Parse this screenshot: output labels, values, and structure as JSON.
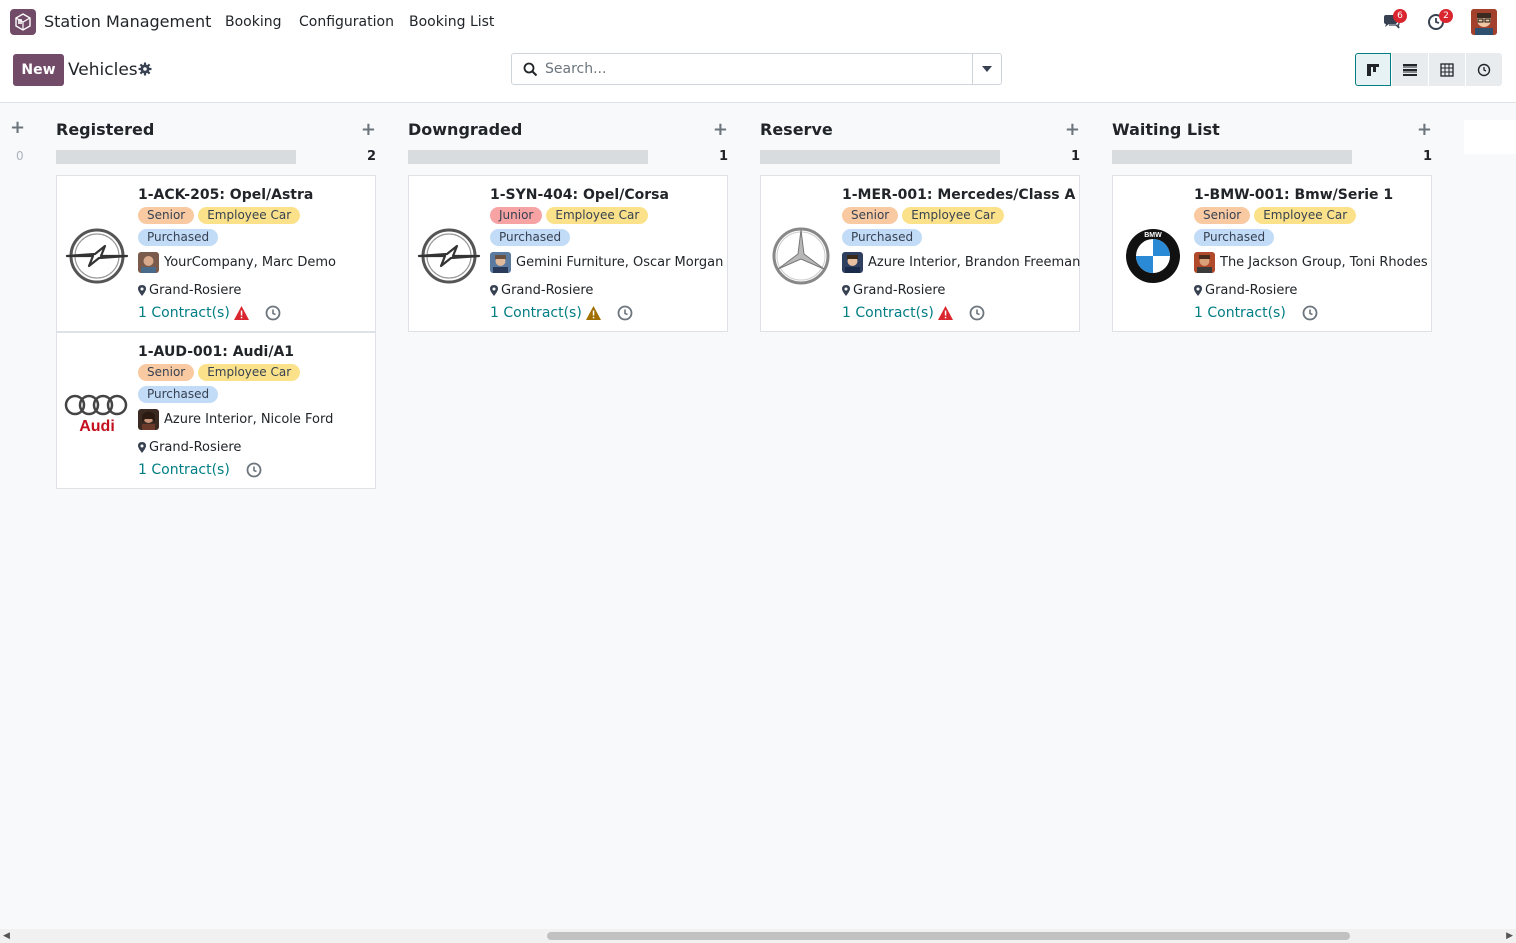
{
  "navbar": {
    "app_name": "Station Management",
    "menu": [
      "Booking",
      "Configuration",
      "Booking List"
    ],
    "messages_count": "6",
    "activities_count": "2"
  },
  "control": {
    "new_label": "New",
    "title": "Vehicles",
    "search_placeholder": "Search..."
  },
  "columns": [
    {
      "title": "Registered",
      "count": "2",
      "cards": [
        {
          "title": "1-ACK-205: Opel/Astra",
          "logo": "opel-logo",
          "tags": [
            "Senior",
            "Employee Car"
          ],
          "status": "Purchased",
          "driver": "YourCompany, Marc Demo",
          "location": "Grand-Rosiere",
          "contracts": "1 Contract(s)",
          "warning": "red"
        },
        {
          "title": "1-AUD-001: Audi/A1",
          "logo": "audi-logo",
          "logo_text": "Audi",
          "tags": [
            "Senior",
            "Employee Car"
          ],
          "status": "Purchased",
          "driver": "Azure Interior, Nicole Ford",
          "location": "Grand-Rosiere",
          "contracts": "1 Contract(s)",
          "warning": ""
        }
      ]
    },
    {
      "title": "Downgraded",
      "count": "1",
      "cards": [
        {
          "title": "1-SYN-404: Opel/Corsa",
          "logo": "opel-logo",
          "tags": [
            "Junior",
            "Employee Car"
          ],
          "status": "Purchased",
          "driver": "Gemini Furniture, Oscar Morgan",
          "location": "Grand-Rosiere",
          "contracts": "1 Contract(s)",
          "warning": "amber"
        }
      ]
    },
    {
      "title": "Reserve",
      "count": "1",
      "cards": [
        {
          "title": "1-MER-001: Mercedes/Class A",
          "logo": "mercedes-logo",
          "tags": [
            "Senior",
            "Employee Car"
          ],
          "status": "Purchased",
          "driver": "Azure Interior, Brandon Freeman",
          "location": "Grand-Rosiere",
          "contracts": "1 Contract(s)",
          "warning": "red"
        }
      ]
    },
    {
      "title": "Waiting List",
      "count": "1",
      "cards": [
        {
          "title": "1-BMW-001: Bmw/Serie 1",
          "logo": "bmw-logo",
          "logo_text": "BMW",
          "tags": [
            "Senior",
            "Employee Car"
          ],
          "status": "Purchased",
          "driver": "The Jackson Group, Toni Rhodes",
          "location": "Grand-Rosiere",
          "contracts": "1 Contract(s)",
          "warning": ""
        }
      ]
    }
  ],
  "folded_column": {
    "count": "0"
  },
  "colors": {
    "brand": "#714b67",
    "link": "#017e84",
    "warning_red": "#d9262f",
    "warning_amber": "#a06f00"
  }
}
